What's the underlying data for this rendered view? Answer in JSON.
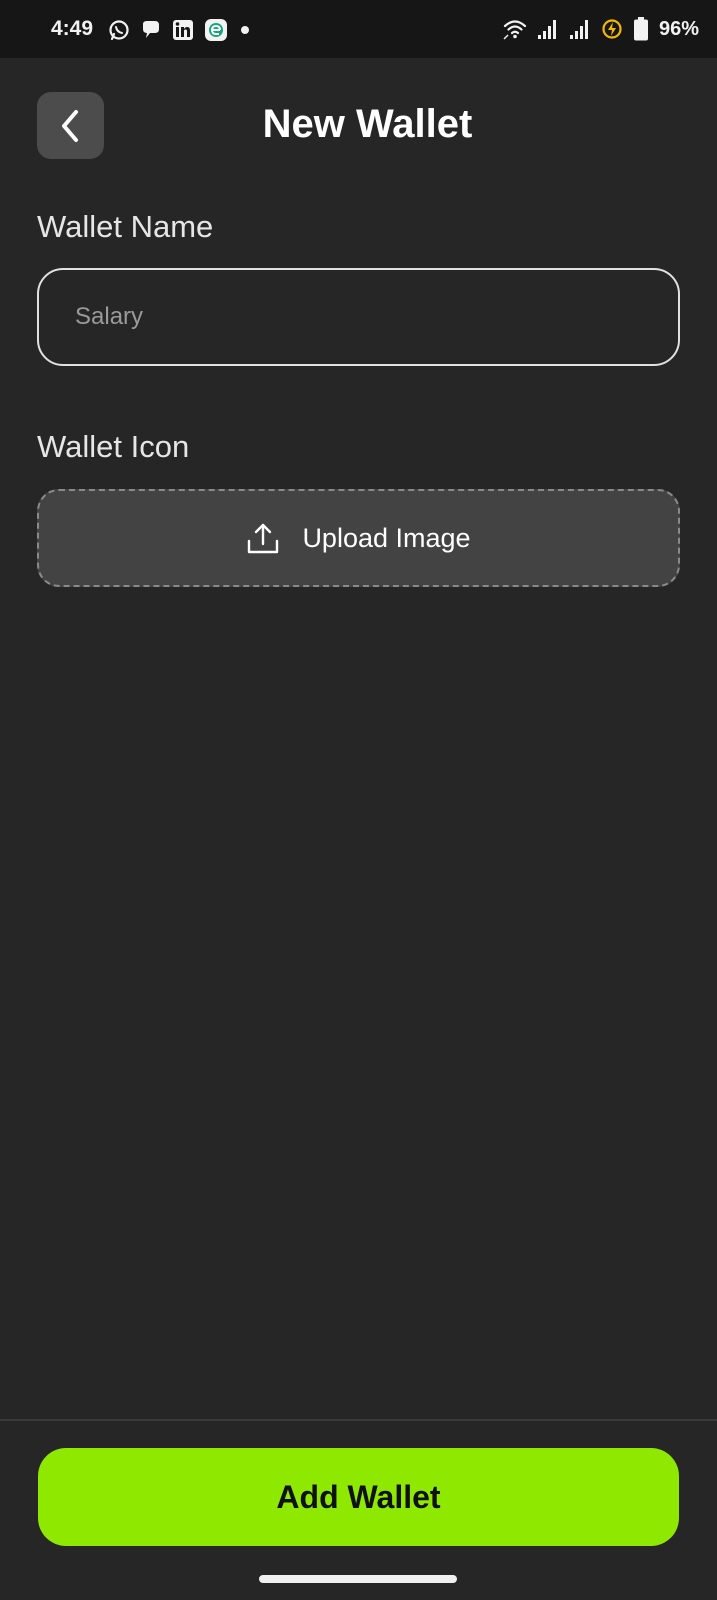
{
  "status_bar": {
    "time": "4:49",
    "battery_text": "96%",
    "left_icons": [
      "whatsapp-icon",
      "chat-bubble-icon",
      "linkedin-icon",
      "app-e-icon",
      "dot-icon"
    ],
    "right_icons": [
      "wifi-icon",
      "signal-icon",
      "signal-icon",
      "battery-saver-icon",
      "battery-icon"
    ]
  },
  "header": {
    "title": "New Wallet",
    "back_icon": "chevron-left-icon"
  },
  "form": {
    "name_label": "Wallet Name",
    "name_placeholder": "Salary",
    "name_value": "",
    "icon_label": "Wallet Icon",
    "upload_label": "Upload Image",
    "upload_icon": "upload-icon"
  },
  "footer": {
    "submit_label": "Add Wallet"
  },
  "colors": {
    "background": "#262626",
    "status_bar": "#161616",
    "accent": "#8fe800",
    "upload_box": "#434343",
    "back_button": "#4c4c4c"
  }
}
